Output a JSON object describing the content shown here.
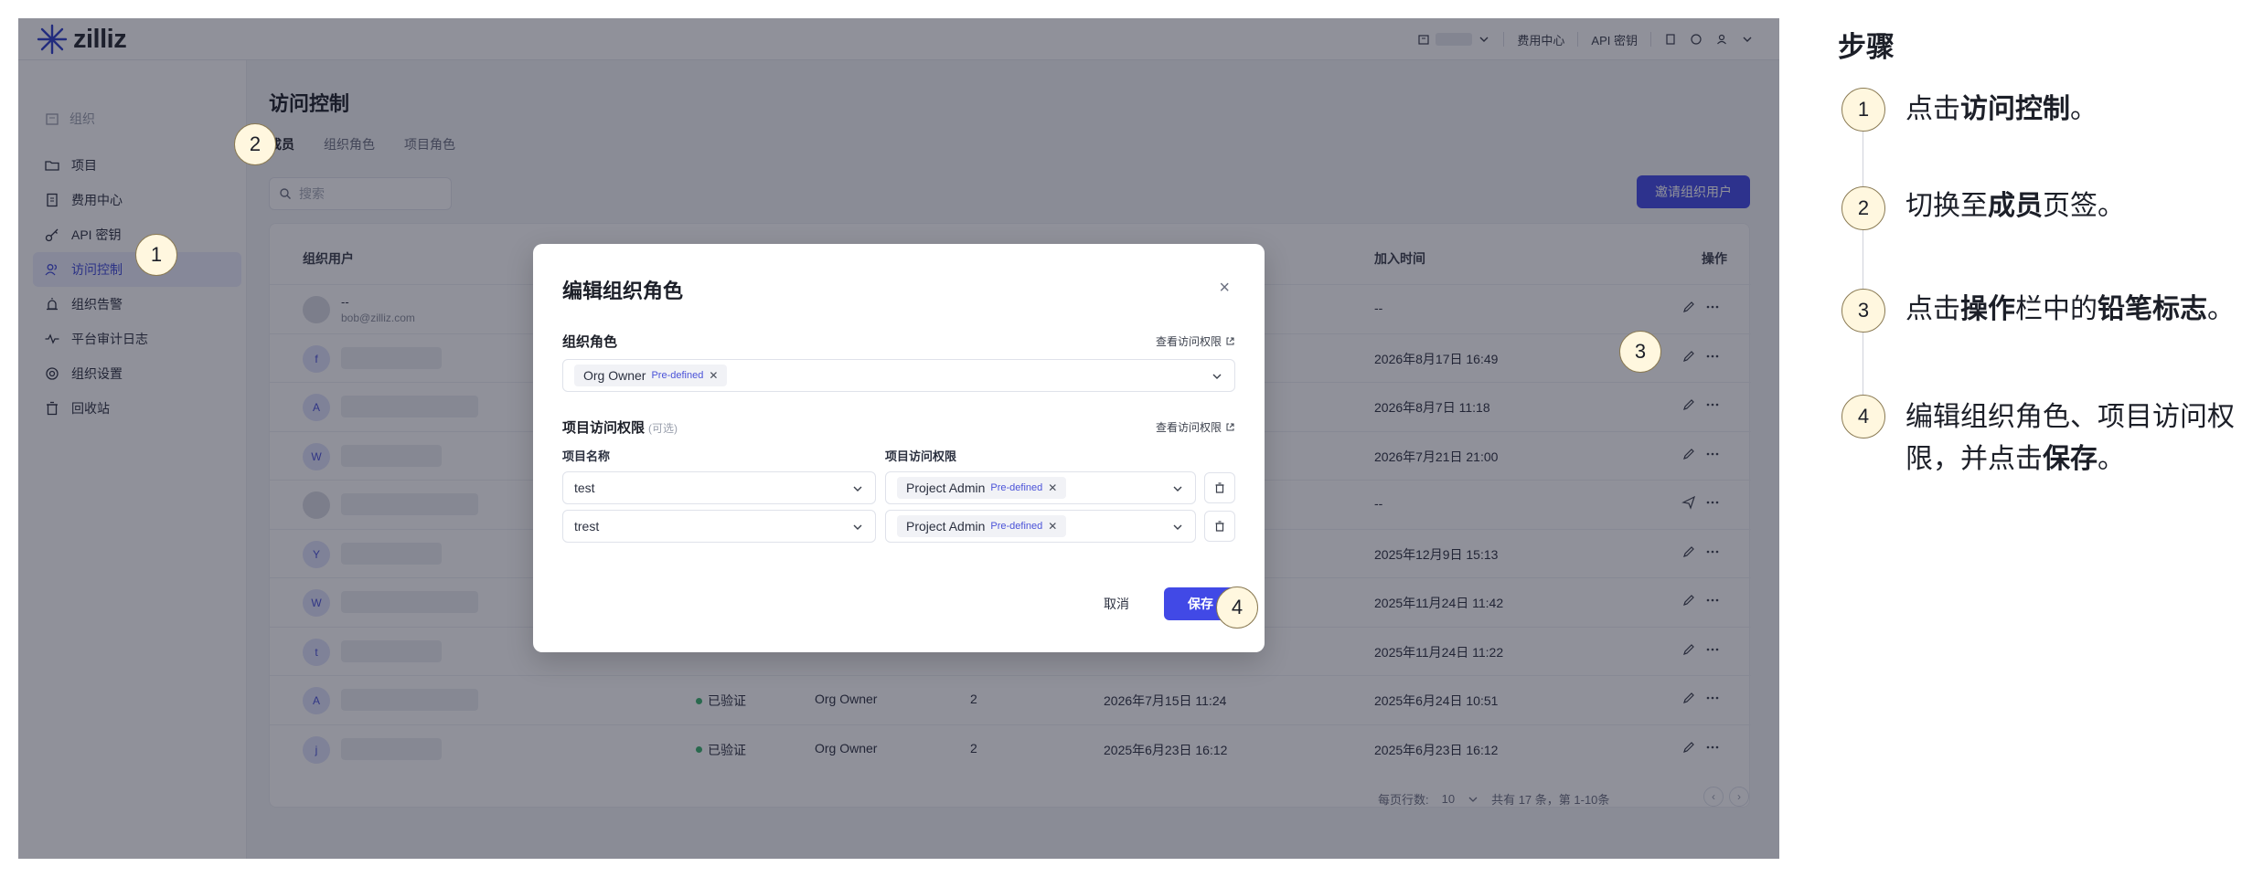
{
  "app": {
    "logo_text": "zilliz"
  },
  "topbar": {
    "billing": "费用中心",
    "api_keys": "API 密钥"
  },
  "sidebar": {
    "org_label": "组织",
    "items": [
      {
        "label": "项目"
      },
      {
        "label": "费用中心"
      },
      {
        "label": "API 密钥"
      },
      {
        "label": "访问控制"
      },
      {
        "label": "组织告警"
      },
      {
        "label": "平台审计日志"
      },
      {
        "label": "组织设置"
      },
      {
        "label": "回收站"
      }
    ]
  },
  "page": {
    "title": "访问控制",
    "tabs": [
      "成员",
      "组织角色",
      "项目角色"
    ],
    "search_placeholder": "搜索",
    "invite_button": "邀请组织用户"
  },
  "table": {
    "headers": {
      "user": "组织用户",
      "joined": "加入时间",
      "actions": "操作"
    },
    "rows": [
      {
        "avatar": "",
        "name": "--",
        "email": "bob@zilliz.com",
        "status": "",
        "role": "",
        "count": "",
        "expires": "",
        "joined": "--"
      },
      {
        "avatar": "f",
        "name": "",
        "email": "",
        "status": "",
        "role": "",
        "count": "",
        "expires": "",
        "joined": "2026年8月17日 16:49"
      },
      {
        "avatar": "A",
        "name": "",
        "email": "",
        "status": "",
        "role": "",
        "count": "",
        "expires": "",
        "joined": "2026年8月7日 11:18"
      },
      {
        "avatar": "W",
        "name": "",
        "email": "",
        "status": "",
        "role": "",
        "count": "",
        "expires": "",
        "joined": "2026年7月21日 21:00"
      },
      {
        "avatar": "",
        "name": "",
        "email": "",
        "status": "",
        "role": "",
        "count": "",
        "expires": "",
        "joined": "--"
      },
      {
        "avatar": "Y",
        "name": "",
        "email": "",
        "status": "",
        "role": "",
        "count": "",
        "expires": "",
        "joined": "2025年12月9日 15:13"
      },
      {
        "avatar": "W",
        "name": "",
        "email": "",
        "status": "",
        "role": "",
        "count": "",
        "expires": "",
        "joined": "2025年11月24日 11:42"
      },
      {
        "avatar": "t",
        "name": "",
        "email": "",
        "status": "",
        "role": "",
        "count": "",
        "expires": "",
        "joined": "2025年11月24日 11:22"
      },
      {
        "avatar": "A",
        "name": "",
        "email": "",
        "status": "已验证",
        "role": "Org Owner",
        "count": "2",
        "expires": "2026年7月15日 11:24",
        "joined": "2025年6月24日 10:51"
      },
      {
        "avatar": "j",
        "name": "",
        "email": "",
        "status": "已验证",
        "role": "Org Owner",
        "count": "2",
        "expires": "2025年6月23日 16:12",
        "joined": "2025年6月23日 16:12"
      }
    ],
    "pager": {
      "per_page_label": "每页行数:",
      "per_page": "10",
      "summary": "共有 17 条，第 1-10条"
    }
  },
  "modal": {
    "title": "编辑组织角色",
    "org_role_label": "组织角色",
    "view_permissions": "查看访问权限",
    "org_role_chip": "Org Owner",
    "predefined": "Pre-defined",
    "project_access_label": "项目访问权限",
    "optional": "(可选)",
    "project_name_label": "项目名称",
    "project_permission_label": "项目访问权限",
    "project_rows": [
      {
        "project": "test",
        "role": "Project Admin"
      },
      {
        "project": "trest",
        "role": "Project Admin"
      }
    ],
    "cancel": "取消",
    "save": "保存"
  },
  "markers": [
    "1",
    "2",
    "3",
    "4"
  ],
  "steps": {
    "title": "步骤",
    "items": [
      {
        "num": "1",
        "parts": [
          "点击",
          "访问控制",
          "。"
        ]
      },
      {
        "num": "2",
        "parts": [
          "切换至",
          "成员",
          "页签。"
        ]
      },
      {
        "num": "3",
        "parts": [
          "点击",
          "操作",
          "栏中的",
          "铅笔标志",
          "。"
        ]
      },
      {
        "num": "4",
        "parts": [
          "编辑组织角色、项目访问权限，并点击",
          "保存",
          "。"
        ]
      }
    ]
  }
}
